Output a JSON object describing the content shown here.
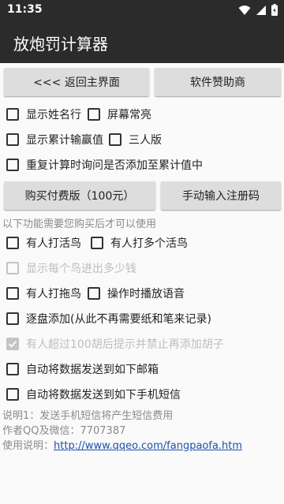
{
  "status": {
    "time": "11:35"
  },
  "app": {
    "title": "放炮罚计算器"
  },
  "top_buttons": {
    "back": "<<< 返回主界面",
    "sponsor": "软件赞助商"
  },
  "options": {
    "show_names": "显示姓名行",
    "screen_on": "屏幕常亮",
    "show_cumulative": "显示累计输赢值",
    "three_player": "三人版",
    "recalc_prompt": "重复计算时询问是否添加至累计值中"
  },
  "purchase_buttons": {
    "buy": "购买付费版（100元）",
    "register": "手动输入注册码"
  },
  "paid_notice": "以下功能需要您购买后才可以使用",
  "paid_options": {
    "live_bird": "有人打活鸟",
    "multi_live_bird": "有人打多个活鸟",
    "bird_amount": "显示每个鸟进出多少钱",
    "drag_bird": "有人打拖鸟",
    "voice": "操作时播放语音",
    "add_per_game": "逐盘添加(从此不再需要纸和笔来记录)",
    "beard_limit": "有人超过100胡后提示并禁止再添加胡子",
    "send_email": "自动将数据发送到如下邮箱",
    "send_sms": "自动将数据发送到如下手机短信"
  },
  "footer": {
    "line1": "说明1：发送手机短信将产生短信费用",
    "line2": "作者QQ及微信：7707387",
    "line3_label": "使用说明：",
    "line3_link": "http://www.qqeo.com/fangpaofa.htm"
  },
  "colors": {
    "bar": "#2b2b2b",
    "button": "#dddddd",
    "link": "#1f4fa8",
    "disabled": "#bdbdbd"
  }
}
